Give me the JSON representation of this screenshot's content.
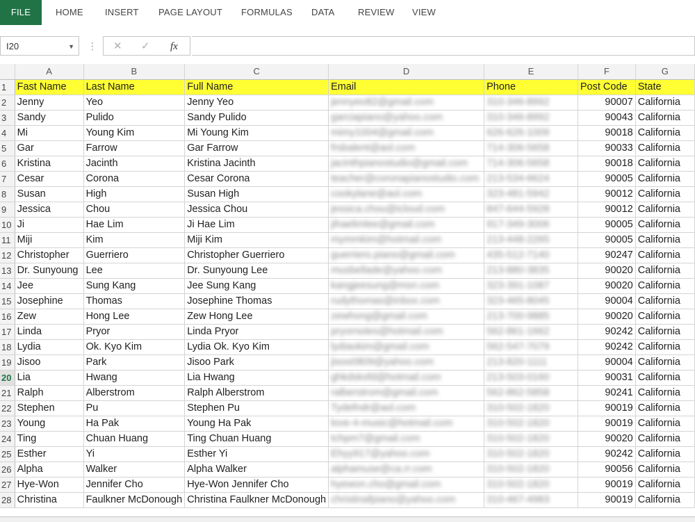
{
  "ribbon": {
    "tabs": [
      "FILE",
      "HOME",
      "INSERT",
      "PAGE LAYOUT",
      "FORMULAS",
      "DATA",
      "REVIEW",
      "VIEW"
    ]
  },
  "formula_bar": {
    "name_box": "I20",
    "cancel_icon": "✕",
    "enter_icon": "✓",
    "fx_label": "fx",
    "content": ""
  },
  "sheet": {
    "active_row": "20",
    "columns": [
      "A",
      "B",
      "C",
      "D",
      "E",
      "F",
      "G"
    ],
    "header": [
      "Fast Name",
      "Last Name",
      "Full Name",
      "Email",
      "Phone",
      "Post Code",
      "State"
    ],
    "rows": [
      {
        "n": "2",
        "first": "Jenny",
        "last": "Yeo",
        "full": "Jenny Yeo",
        "email": "jennyeo82@gmail.com",
        "phone": "310-346-8992",
        "zip": "90007",
        "state": "California"
      },
      {
        "n": "3",
        "first": "Sandy",
        "last": "Pulido",
        "full": "Sandy Pulido",
        "email": "garciapiano@yahoo.com",
        "phone": "310-346-8992",
        "zip": "90043",
        "state": "California"
      },
      {
        "n": "4",
        "first": "Mi",
        "last": "Young Kim",
        "full": "Mi Young Kim",
        "email": "mimy1004@gmail.com",
        "phone": "626-626-1009",
        "zip": "90018",
        "state": "California"
      },
      {
        "n": "5",
        "first": "Gar",
        "last": "Farrow",
        "full": "Gar Farrow",
        "email": "frsbalent@aol.com",
        "phone": "714-306-5658",
        "zip": "90033",
        "state": "California"
      },
      {
        "n": "6",
        "first": "Kristina",
        "last": "Jacinth",
        "full": "Kristina Jacinth",
        "email": "jacinthpianostudio@gmail.com",
        "phone": "714-306-5658",
        "zip": "90018",
        "state": "California"
      },
      {
        "n": "7",
        "first": "Cesar",
        "last": "Corona",
        "full": "Cesar Corona",
        "email": "teacher@coronapianostudio.com",
        "phone": "213-534-6624",
        "zip": "90005",
        "state": "California"
      },
      {
        "n": "8",
        "first": "Susan",
        "last": "High",
        "full": "Susan High",
        "email": "cookylane@aol.com",
        "phone": "323-481-5942",
        "zip": "90012",
        "state": "California"
      },
      {
        "n": "9",
        "first": "Jessica",
        "last": "Chou",
        "full": "Jessica Chou",
        "email": "jessica.chou@icloud.com",
        "phone": "847-644-5928",
        "zip": "90012",
        "state": "California"
      },
      {
        "n": "10",
        "first": "Ji",
        "last": "Hae Lim",
        "full": "Ji Hae Lim",
        "email": "jihaelimlee@gmail.com",
        "phone": "917-349-3006",
        "zip": "90005",
        "state": "California"
      },
      {
        "n": "11",
        "first": "Miji",
        "last": "Kim",
        "full": "Miji Kim",
        "email": "mymmkim@hotmail.com",
        "phone": "213-448-2265",
        "zip": "90005",
        "state": "California"
      },
      {
        "n": "12",
        "first": "Christopher",
        "last": "Guerriero",
        "full": "Christopher Guerriero",
        "email": "guerriero.piano@gmail.com",
        "phone": "435-512-7140",
        "zip": "90247",
        "state": "California"
      },
      {
        "n": "13",
        "first": "Dr. Sunyoung",
        "last": "Lee",
        "full": "Dr. Sunyoung Lee",
        "email": "musbellade@yahoo.com",
        "phone": "213-880-3835",
        "zip": "90020",
        "state": "California"
      },
      {
        "n": "14",
        "first": "Jee",
        "last": "Sung Kang",
        "full": "Jee Sung Kang",
        "email": "kangjeesung@msn.com",
        "phone": "323-391-1087",
        "zip": "90020",
        "state": "California"
      },
      {
        "n": "15",
        "first": "Josephine",
        "last": "Thomas",
        "full": "Josephine Thomas",
        "email": "rudythomas@inbox.com",
        "phone": "323-465-8045",
        "zip": "90004",
        "state": "California"
      },
      {
        "n": "16",
        "first": "Zew",
        "last": "Hong Lee",
        "full": "Zew Hong Lee",
        "email": "zewhong@gmail.com",
        "phone": "213-700-9885",
        "zip": "90020",
        "state": "California"
      },
      {
        "n": "17",
        "first": "Linda",
        "last": "Pryor",
        "full": "Linda Pryor",
        "email": "pryornotes@hotmail.com",
        "phone": "562-861-1662",
        "zip": "90242",
        "state": "California"
      },
      {
        "n": "18",
        "first": "Lydia",
        "last": "Ok. Kyo Kim",
        "full": "Lydia Ok. Kyo Kim",
        "email": "lydiaokim@gmail.com",
        "phone": "562-547-7079",
        "zip": "90242",
        "state": "California"
      },
      {
        "n": "19",
        "first": "Jisoo",
        "last": "Park",
        "full": "Jisoo Park",
        "email": "jisoo0809@yahoo.com",
        "phone": "213-820-1111",
        "zip": "90004",
        "state": "California"
      },
      {
        "n": "20",
        "first": "Lia",
        "last": "Hwang",
        "full": "Lia Hwang",
        "email": "ghkdsksfd@hotmail.com",
        "phone": "213-503-0160",
        "zip": "90031",
        "state": "California"
      },
      {
        "n": "21",
        "first": "Ralph",
        "last": "Alberstrom",
        "full": "Ralph Alberstrom",
        "email": "ralberstrom@gmail.com",
        "phone": "562-862-5858",
        "zip": "90241",
        "state": "California"
      },
      {
        "n": "22",
        "first": "Stephen",
        "last": "Pu",
        "full": "Stephen Pu",
        "email": "Tydefndr@aol.com",
        "phone": "310-502-1820",
        "zip": "90019",
        "state": "California"
      },
      {
        "n": "23",
        "first": "Young",
        "last": "Ha Pak",
        "full": "Young Ha Pak",
        "email": "love-4-music@hotmail.com",
        "phone": "310-502-1820",
        "zip": "90019",
        "state": "California"
      },
      {
        "n": "24",
        "first": "Ting",
        "last": "Chuan Huang",
        "full": "Ting Chuan Huang",
        "email": "tchpm7@gmail.com",
        "phone": "310-502-1820",
        "zip": "90020",
        "state": "California"
      },
      {
        "n": "25",
        "first": "Esther",
        "last": "Yi",
        "full": "Esther Yi",
        "email": "Ehyy917@yahoo.com",
        "phone": "310-502-1820",
        "zip": "90242",
        "state": "California"
      },
      {
        "n": "26",
        "first": "Alpha",
        "last": "Walker",
        "full": "Alpha Walker",
        "email": "alphamuse@ca.rr.com",
        "phone": "310-502-1820",
        "zip": "90056",
        "state": "California"
      },
      {
        "n": "27",
        "first": "Hye-Won",
        "last": "Jennifer Cho",
        "full": "Hye-Won Jennifer Cho",
        "email": "hyewon.cho@gmail.com",
        "phone": "310-502-1820",
        "zip": "90019",
        "state": "California"
      },
      {
        "n": "28",
        "first": "Christina",
        "last": "Faulkner McDonough",
        "full": "Christina Faulkner McDonough",
        "email": "christinafpiano@yahoo.com",
        "phone": "310-467-4983",
        "zip": "90019",
        "state": "California"
      }
    ]
  },
  "colors": {
    "file_tab": "#217346",
    "header_highlight": "#ffff33",
    "active_row_num": "#217346"
  }
}
